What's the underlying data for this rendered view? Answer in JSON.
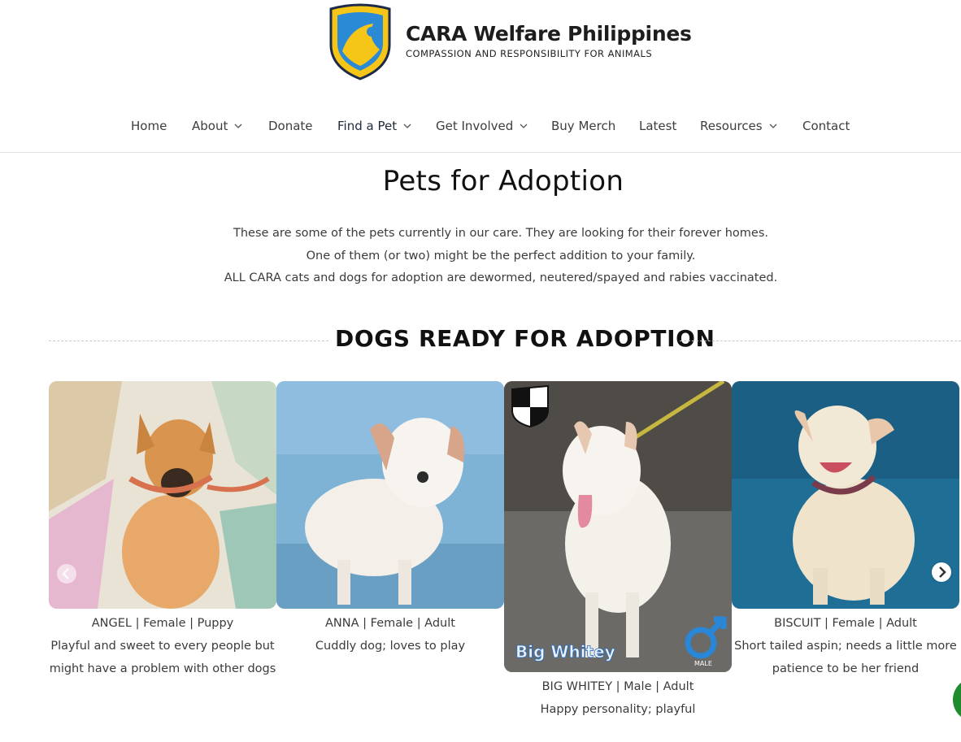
{
  "brand": {
    "title": "CARA Welfare Philippines",
    "tagline": "COMPASSION AND RESPONSIBILITY FOR ANIMALS",
    "logo_colors": {
      "yellow": "#f5c518",
      "blue": "#2a8ad6",
      "outline": "#1e2a4a"
    }
  },
  "nav": {
    "items": [
      {
        "label": "Home",
        "dropdown": false
      },
      {
        "label": "About",
        "dropdown": true
      },
      {
        "label": "Donate",
        "dropdown": false
      },
      {
        "label": "Find a Pet",
        "dropdown": true,
        "active": true
      },
      {
        "label": "Get Involved",
        "dropdown": true
      },
      {
        "label": "Buy Merch",
        "dropdown": false
      },
      {
        "label": "Latest",
        "dropdown": false
      },
      {
        "label": "Resources",
        "dropdown": true
      },
      {
        "label": "Contact",
        "dropdown": false
      }
    ]
  },
  "page": {
    "title": "Pets for Adoption",
    "intro": [
      "These are some of the pets currently in our care. They are looking for their forever homes.",
      "One of them (or two) might be the perfect addition to your family.",
      "ALL CARA cats and dogs for adoption are dewormed, neutered/spayed and rabies vaccinated."
    ]
  },
  "section": {
    "title": "DOGS READY FOR ADOPTION"
  },
  "pets": [
    {
      "info": "ANGEL | Female | Puppy",
      "desc": "Playful and sweet to every people but might have a problem with other dogs",
      "icon": "dog-photo-icon"
    },
    {
      "info": "ANNA | Female | Adult",
      "desc": "Cuddly dog; loves to play",
      "icon": "dog-photo-icon"
    },
    {
      "info": "BIG WHITEY | Male | Adult",
      "desc": "Happy personality; playful",
      "overlay_name": "Big Whitey",
      "overlay_gender": "MALE",
      "icon": "dog-photo-icon"
    },
    {
      "info": "BISCUIT | Female | Adult",
      "desc": "Short tailed aspin; needs a little more patience to be her friend",
      "icon": "dog-photo-icon"
    }
  ],
  "carousel": {
    "next_icon": "chevron-right-icon",
    "prev_icon": "chevron-left-icon"
  },
  "colors": {
    "accent_green": "#1e8b2e",
    "text": "#3b3b3b"
  }
}
